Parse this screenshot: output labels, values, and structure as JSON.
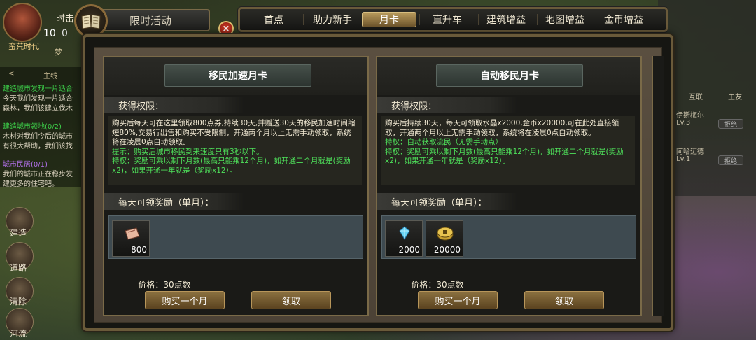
{
  "hud": {
    "player_name": "蛮荒时代",
    "time_label": "时击",
    "level": "10",
    "stat_value": "0",
    "mini_label": "梦"
  },
  "quest": {
    "header_arrow": "<",
    "header_title": "主线",
    "lines": [
      {
        "text": "建造城市发现一片适合",
        "color": "green"
      },
      {
        "text": "今天我们发现一片适合",
        "color": "white"
      },
      {
        "text": "森林，我们该建立伐木",
        "color": "white"
      },
      {
        "text": "建造城市领地(0/2)",
        "color": "green"
      },
      {
        "text": "木材对我们今后的城市",
        "color": "white"
      },
      {
        "text": "有很大帮助，我们该找",
        "color": "white"
      },
      {
        "text": "城市民居(0/1)",
        "color": "purple"
      },
      {
        "text": "我们的城市正在稳步发",
        "color": "white"
      },
      {
        "text": "建更多的住宅吧。",
        "color": "white"
      }
    ]
  },
  "side_buttons": [
    "建造",
    "道路",
    "清除",
    "河流"
  ],
  "right_panel": {
    "tab1": "互联",
    "tab2": "主友",
    "friends": [
      {
        "name": "伊斯梅尔",
        "level": "Lv.3",
        "button": "拒绝"
      },
      {
        "name": "阿哈迈德",
        "level": "Lv.1",
        "button": "拒绝"
      }
    ]
  },
  "window": {
    "title": "限时活动",
    "close_symbol": "×"
  },
  "tabs": [
    {
      "label": "首点",
      "active": false
    },
    {
      "label": "助力新手",
      "active": false
    },
    {
      "label": "月卡",
      "active": true
    },
    {
      "label": "直升车",
      "active": false
    },
    {
      "label": "建筑增益",
      "active": false
    },
    {
      "label": "地图增益",
      "active": false
    },
    {
      "label": "金币增益",
      "active": false
    }
  ],
  "cards": [
    {
      "title": "移民加速月卡",
      "perm_label": "获得权限：",
      "desc": {
        "white": "购买后每天可在这里领取800点券,持续30天,并赠送30天的移民加速时间缩短80%,交易行出售和购买不受限制，开通两个月以上无需手动领取，系统将在凌晨0点自动领取。",
        "green": "提示：购买后城市移民到来速度只有3秒以下。\n特权：奖励可乘以剩下月数(最高只能乘12个月)，如开通二个月就是(奖励x2)，如果开通一年就是（奖励x12）。"
      },
      "reward_label": "每天可领奖励（单月）：",
      "rewards": [
        {
          "icon": "coupon-icon",
          "qty": "800"
        }
      ],
      "price": "价格：30点数",
      "buy_button": "购买一个月",
      "claim_button": "领取"
    },
    {
      "title": "自动移民月卡",
      "perm_label": "获得权限：",
      "desc": {
        "white": "购买后持续30天，每天可领取水晶x2000,金币x20000,可在此处直接领取，开通两个月以上无需手动领取，系统将在凌晨0点自动领取。",
        "green": "特权：自动获取流民（无需手动点）\n特权：奖励可乘以剩下月数(最高只能乘12个月)，如开通二个月就是(奖励x2)，如果开通一年就是（奖励x12）。"
      },
      "reward_label": "每天可领奖励（单月）：",
      "rewards": [
        {
          "icon": "crystal-icon",
          "qty": "2000"
        },
        {
          "icon": "gold-coin-icon",
          "qty": "20000"
        }
      ],
      "price": "价格：30点数",
      "buy_button": "购买一个月",
      "claim_button": "领取"
    }
  ],
  "colors": {
    "frame_gold": "#6a5a3a",
    "highlight_green": "#4ee05a",
    "button_brown": "#8a7040"
  }
}
